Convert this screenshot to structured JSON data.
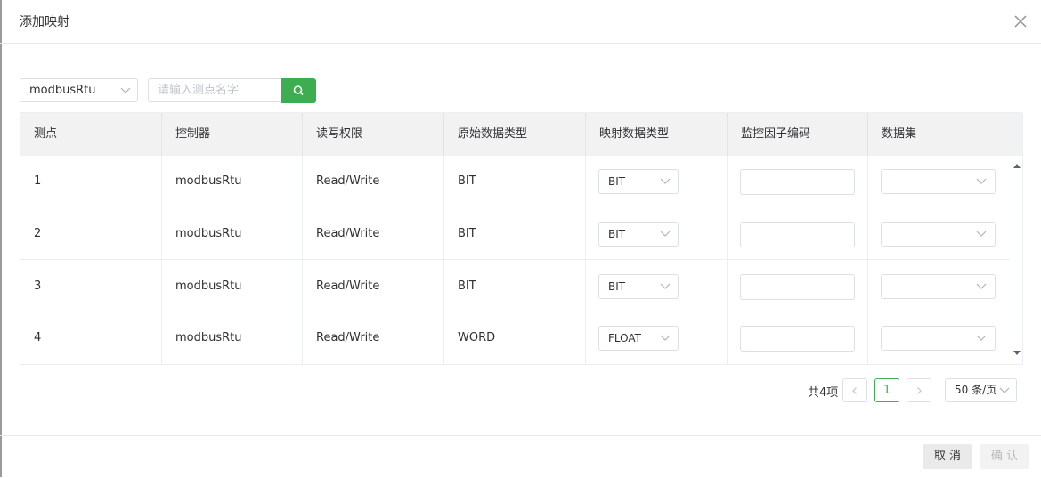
{
  "dialog": {
    "title": "添加映射"
  },
  "toolbar": {
    "controller_select": "modbusRtu",
    "search_placeholder": "请输入测点名字"
  },
  "table": {
    "headers": [
      "测点",
      "控制器",
      "读写权限",
      "原始数据类型",
      "映射数据类型",
      "监控因子编码",
      "数据集"
    ],
    "rows": [
      {
        "point": "1",
        "controller": "modbusRtu",
        "rw": "Read/Write",
        "raw_type": "BIT",
        "map_type": "BIT"
      },
      {
        "point": "2",
        "controller": "modbusRtu",
        "rw": "Read/Write",
        "raw_type": "BIT",
        "map_type": "BIT"
      },
      {
        "point": "3",
        "controller": "modbusRtu",
        "rw": "Read/Write",
        "raw_type": "BIT",
        "map_type": "BIT"
      },
      {
        "point": "4",
        "controller": "modbusRtu",
        "rw": "Read/Write",
        "raw_type": "WORD",
        "map_type": "FLOAT"
      }
    ]
  },
  "pagination": {
    "total": "共4项",
    "current_page": "1",
    "page_size": "50 条/页"
  },
  "footer": {
    "cancel": "取 消",
    "confirm": "确 认"
  },
  "colors": {
    "accent": "#3dae50",
    "header_bg": "#f2f2f2",
    "border": "#dcdfe6"
  }
}
